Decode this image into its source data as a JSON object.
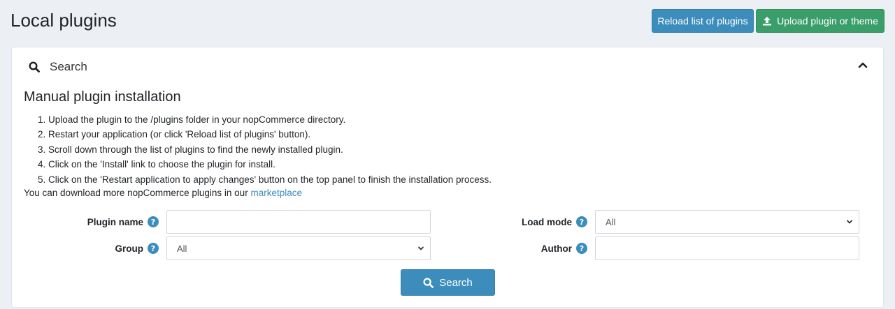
{
  "page": {
    "title": "Local plugins"
  },
  "header_buttons": {
    "reload_label": "Reload list of plugins",
    "upload_label": "Upload plugin or theme"
  },
  "search_panel": {
    "heading": "Search",
    "section_title": "Manual plugin installation",
    "steps": [
      "Upload the plugin to the /plugins folder in your nopCommerce directory.",
      "Restart your application (or click 'Reload list of plugins' button).",
      "Scroll down through the list of plugins to find the newly installed plugin.",
      "Click on the 'Install' link to choose the plugin for install.",
      "Click on the 'Restart application to apply changes' button on the top panel to finish the installation process."
    ],
    "download_text": "You can download more nopCommerce plugins in our",
    "marketplace_link": "marketplace"
  },
  "form": {
    "plugin_name_label": "Plugin name",
    "plugin_name_value": "",
    "group_label": "Group",
    "group_value": "All",
    "load_mode_label": "Load mode",
    "load_mode_value": "All",
    "author_label": "Author",
    "author_value": "",
    "search_button_label": "Search"
  },
  "colors": {
    "primary": "#3c8dbc",
    "success": "#3a9e6b",
    "help": "#3c8dbc",
    "background": "#ecf0f5"
  },
  "icons": {
    "upload": "upload-icon",
    "search": "search-icon",
    "collapse": "chevron-up-icon",
    "help": "question-circle-icon",
    "select": "chevron-down-icon"
  }
}
